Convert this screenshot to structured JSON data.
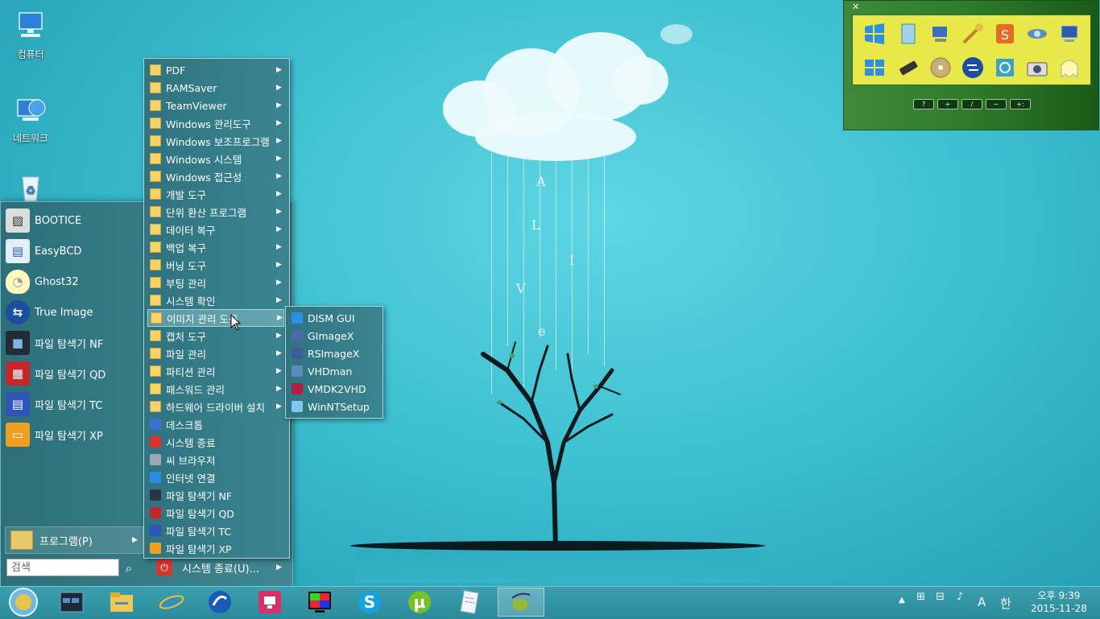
{
  "desktop": {
    "icons": [
      {
        "label": "컴퓨터",
        "icon": "computer-icon"
      },
      {
        "label": "네트워크",
        "icon": "network-globe-icon"
      },
      {
        "label": "",
        "icon": "recycle-bin-icon"
      }
    ],
    "wallpaper_letters": [
      "A",
      "L",
      "I",
      "V",
      "e"
    ]
  },
  "start_menu": {
    "pinned": [
      {
        "label": "BOOTICE",
        "icon": "bootice-icon"
      },
      {
        "label": "EasyBCD",
        "icon": "easybcd-icon"
      },
      {
        "label": "Ghost32",
        "icon": "ghost-icon"
      },
      {
        "label": "True Image",
        "icon": "true-image-icon"
      },
      {
        "label": "파일 탐색기 NF",
        "icon": "folder-dark-icon"
      },
      {
        "label": "파일 탐색기 QD",
        "icon": "qdir-icon"
      },
      {
        "label": "파일 탐색기 TC",
        "icon": "floppy-icon"
      },
      {
        "label": "파일 탐색기 XP",
        "icon": "folder-orange-icon"
      }
    ],
    "programs_label": "프로그램(P)",
    "search_placeholder": "검색",
    "shutdown_label": "시스템 종료(U)..."
  },
  "programs_menu": {
    "folders": [
      "PDF",
      "RAMSaver",
      "TeamViewer",
      "Windows 관리도구",
      "Windows 보조프로그램",
      "Windows 시스템",
      "Windows 접근성",
      "개발 도구",
      "단위 환산 프로그램",
      "데이터 복구",
      "백업 복구",
      "버닝 도구",
      "부팅 관리",
      "시스템 확인",
      "이미지 관리 도구",
      "캡처 도구",
      "파일 관리",
      "파티션 관리",
      "패스워드 관리",
      "하드웨어 드라이버 설치"
    ],
    "highlighted": "이미지 관리 도구",
    "shortcuts": [
      {
        "label": "데스크톱",
        "icon": "desktop-icon",
        "color": "#3b6fd0"
      },
      {
        "label": "시스템 종료",
        "icon": "power-icon",
        "color": "#d9342b"
      },
      {
        "label": "씨 브라우저",
        "icon": "c-browser-icon",
        "color": "#9aa9b4"
      },
      {
        "label": "인터넷 연결",
        "icon": "internet-explorer-icon",
        "color": "#2a8be0"
      },
      {
        "label": "파일 탐색기 NF",
        "icon": "folder-dark-icon",
        "color": "#2b3440"
      },
      {
        "label": "파일 탐색기 QD",
        "icon": "qdir-icon",
        "color": "#c4262b"
      },
      {
        "label": "파일 탐색기 TC",
        "icon": "floppy-icon",
        "color": "#2f55b8"
      },
      {
        "label": "파일 탐색기 XP",
        "icon": "folder-orange-icon",
        "color": "#f0a020"
      }
    ]
  },
  "image_submenu": {
    "items": [
      {
        "label": "DISM GUI",
        "icon": "windows-logo-icon",
        "color": "#2d8fe0"
      },
      {
        "label": "GImageX",
        "icon": "gimagex-icon",
        "color": "#4d6aa8"
      },
      {
        "label": "RSImageX",
        "icon": "rsimagex-icon",
        "color": "#3d5c9a"
      },
      {
        "label": "VHDman",
        "icon": "vhdman-icon",
        "color": "#5c8cbf"
      },
      {
        "label": "VMDK2VHD",
        "icon": "vmdk-icon",
        "color": "#b02040"
      },
      {
        "label": "WinNTSetup",
        "icon": "setup-icon",
        "color": "#7fc8e8"
      }
    ]
  },
  "toolbar_widget": {
    "close_label": "✕",
    "buttons": [
      "?",
      "+",
      "/",
      "~",
      "+:"
    ]
  },
  "taskbar": {
    "apps": [
      {
        "name": "start-orb-icon"
      },
      {
        "name": "dark-app-icon"
      },
      {
        "name": "file-explorer-icon"
      },
      {
        "name": "internet-explorer-icon"
      },
      {
        "name": "browser-swirl-icon"
      },
      {
        "name": "remote-app-icon"
      },
      {
        "name": "color-test-icon"
      },
      {
        "name": "skype-icon"
      },
      {
        "name": "utorrent-icon"
      },
      {
        "name": "notepad-icon"
      },
      {
        "name": "olive-app-icon"
      }
    ],
    "tray": {
      "ime_a": "A",
      "ime_han": "한",
      "time": "오후 9:39",
      "date": "2015-11-28"
    }
  }
}
